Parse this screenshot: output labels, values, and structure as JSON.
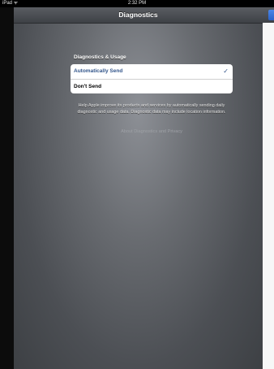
{
  "status_bar": {
    "carrier": "iPad ᯤ",
    "time": "2:32 PM"
  },
  "nav": {
    "title": "Diagnostics"
  },
  "section": {
    "header": "Diagnostics & Usage",
    "options": [
      {
        "label": "Automatically Send",
        "selected": true
      },
      {
        "label": "Don't Send",
        "selected": false
      }
    ],
    "check_glyph": "✓"
  },
  "footer": {
    "text": "Help Apple improve its products and services by automatically sending daily diagnostic and usage data. Diagnostic data may include location information.",
    "link": "About Diagnostics and Privacy"
  },
  "colors": {
    "selected_text": "#32558a",
    "accent_button": "#2a62c8"
  }
}
